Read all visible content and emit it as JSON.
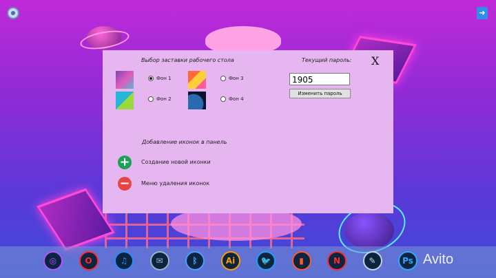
{
  "panel": {
    "wallpaper_title": "Выбор заставки рабочего стола",
    "password_title": "Текущий пароль:",
    "close_label": "X",
    "wallpapers": [
      {
        "label": "Фон 1",
        "selected": true
      },
      {
        "label": "Фон 2",
        "selected": false
      },
      {
        "label": "Фон 3",
        "selected": false
      },
      {
        "label": "Фон 4",
        "selected": false
      }
    ],
    "password_value": "1905",
    "change_password_label": "Изменить пароль",
    "add_icons_title": "Добавление иконок в панель",
    "create_icon_label": "Создание новой иконки",
    "delete_icon_label": "Меню удаления иконок",
    "plus_symbol": "+",
    "minus_symbol": "−"
  },
  "taskbar": {
    "icons": [
      {
        "name": "globe-icon",
        "glyph": "◎",
        "color": "#b056ff"
      },
      {
        "name": "opera-icon",
        "glyph": "O",
        "color": "#ff2a2a"
      },
      {
        "name": "music-icon",
        "glyph": "♫",
        "color": "#2a8cff"
      },
      {
        "name": "mail-icon",
        "glyph": "✉",
        "color": "#9fb3c8"
      },
      {
        "name": "bluetooth-icon",
        "glyph": "ᛒ",
        "color": "#4aa0ff"
      },
      {
        "name": "illustrator-icon",
        "glyph": "Ai",
        "color": "#ff9a00"
      },
      {
        "name": "twitter-icon",
        "glyph": "🐦",
        "color": "#1da1f2"
      },
      {
        "name": "files-icon",
        "glyph": "▮",
        "color": "#ff5a2a"
      },
      {
        "name": "onenote-icon",
        "glyph": "N",
        "color": "#ff2a2a"
      },
      {
        "name": "pen-icon",
        "glyph": "✎",
        "color": "#c7d3e0"
      },
      {
        "name": "photoshop-icon",
        "glyph": "Ps",
        "color": "#31a8ff"
      }
    ]
  },
  "watermark": "Avito"
}
